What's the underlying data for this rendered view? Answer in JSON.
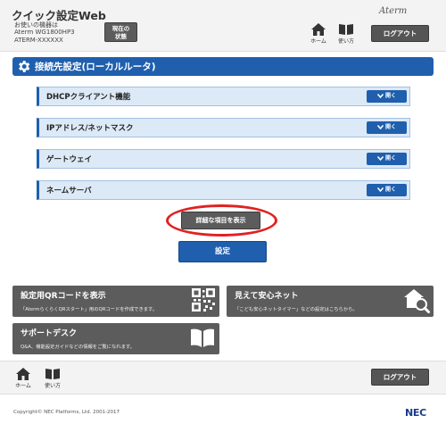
{
  "header": {
    "app_title": "クイック設定Web",
    "device_label": "お使いの機器は",
    "device_name": "Aterm WG1800HP3",
    "device_id": "ATERM-XXXXXX",
    "status_button_line1": "現在の",
    "status_button_line2": "状態",
    "brand": "Aterm",
    "nav_home": "ホーム",
    "nav_howto": "使い方",
    "logout": "ログアウト"
  },
  "section": {
    "title": "接続先設定(ローカルルータ)"
  },
  "accordion": {
    "open_label": "開く",
    "items": [
      {
        "label": "DHCPクライアント機能"
      },
      {
        "label": "IPアドレス/ネットマスク"
      },
      {
        "label": "ゲートウェイ"
      },
      {
        "label": "ネームサーバ"
      }
    ]
  },
  "actions": {
    "show_details": "詳細な項目を表示",
    "apply": "設定"
  },
  "tiles": {
    "qr_title": "設定用QRコードを表示",
    "qr_desc": "「AtermらくらくQRスタート」用のQRコードを作成できます。",
    "timer_title": "見えて安心ネット",
    "timer_desc": "「こども安心ネットタイマー」などの設定はこちらから。",
    "support_title": "サポートデスク",
    "support_desc": "Q&A、機能設定ガイドなどの情報をご覧になれます。"
  },
  "footer": {
    "nav_home": "ホーム",
    "nav_howto": "使い方",
    "logout": "ログアウト",
    "copyright": "Copyright© NEC Platforms, Ltd. 2001-2017",
    "logo": "NEC"
  },
  "colors": {
    "accent_blue": "#1f5fae",
    "button_gray": "#5c5c5c",
    "highlight_red": "#e02222"
  }
}
